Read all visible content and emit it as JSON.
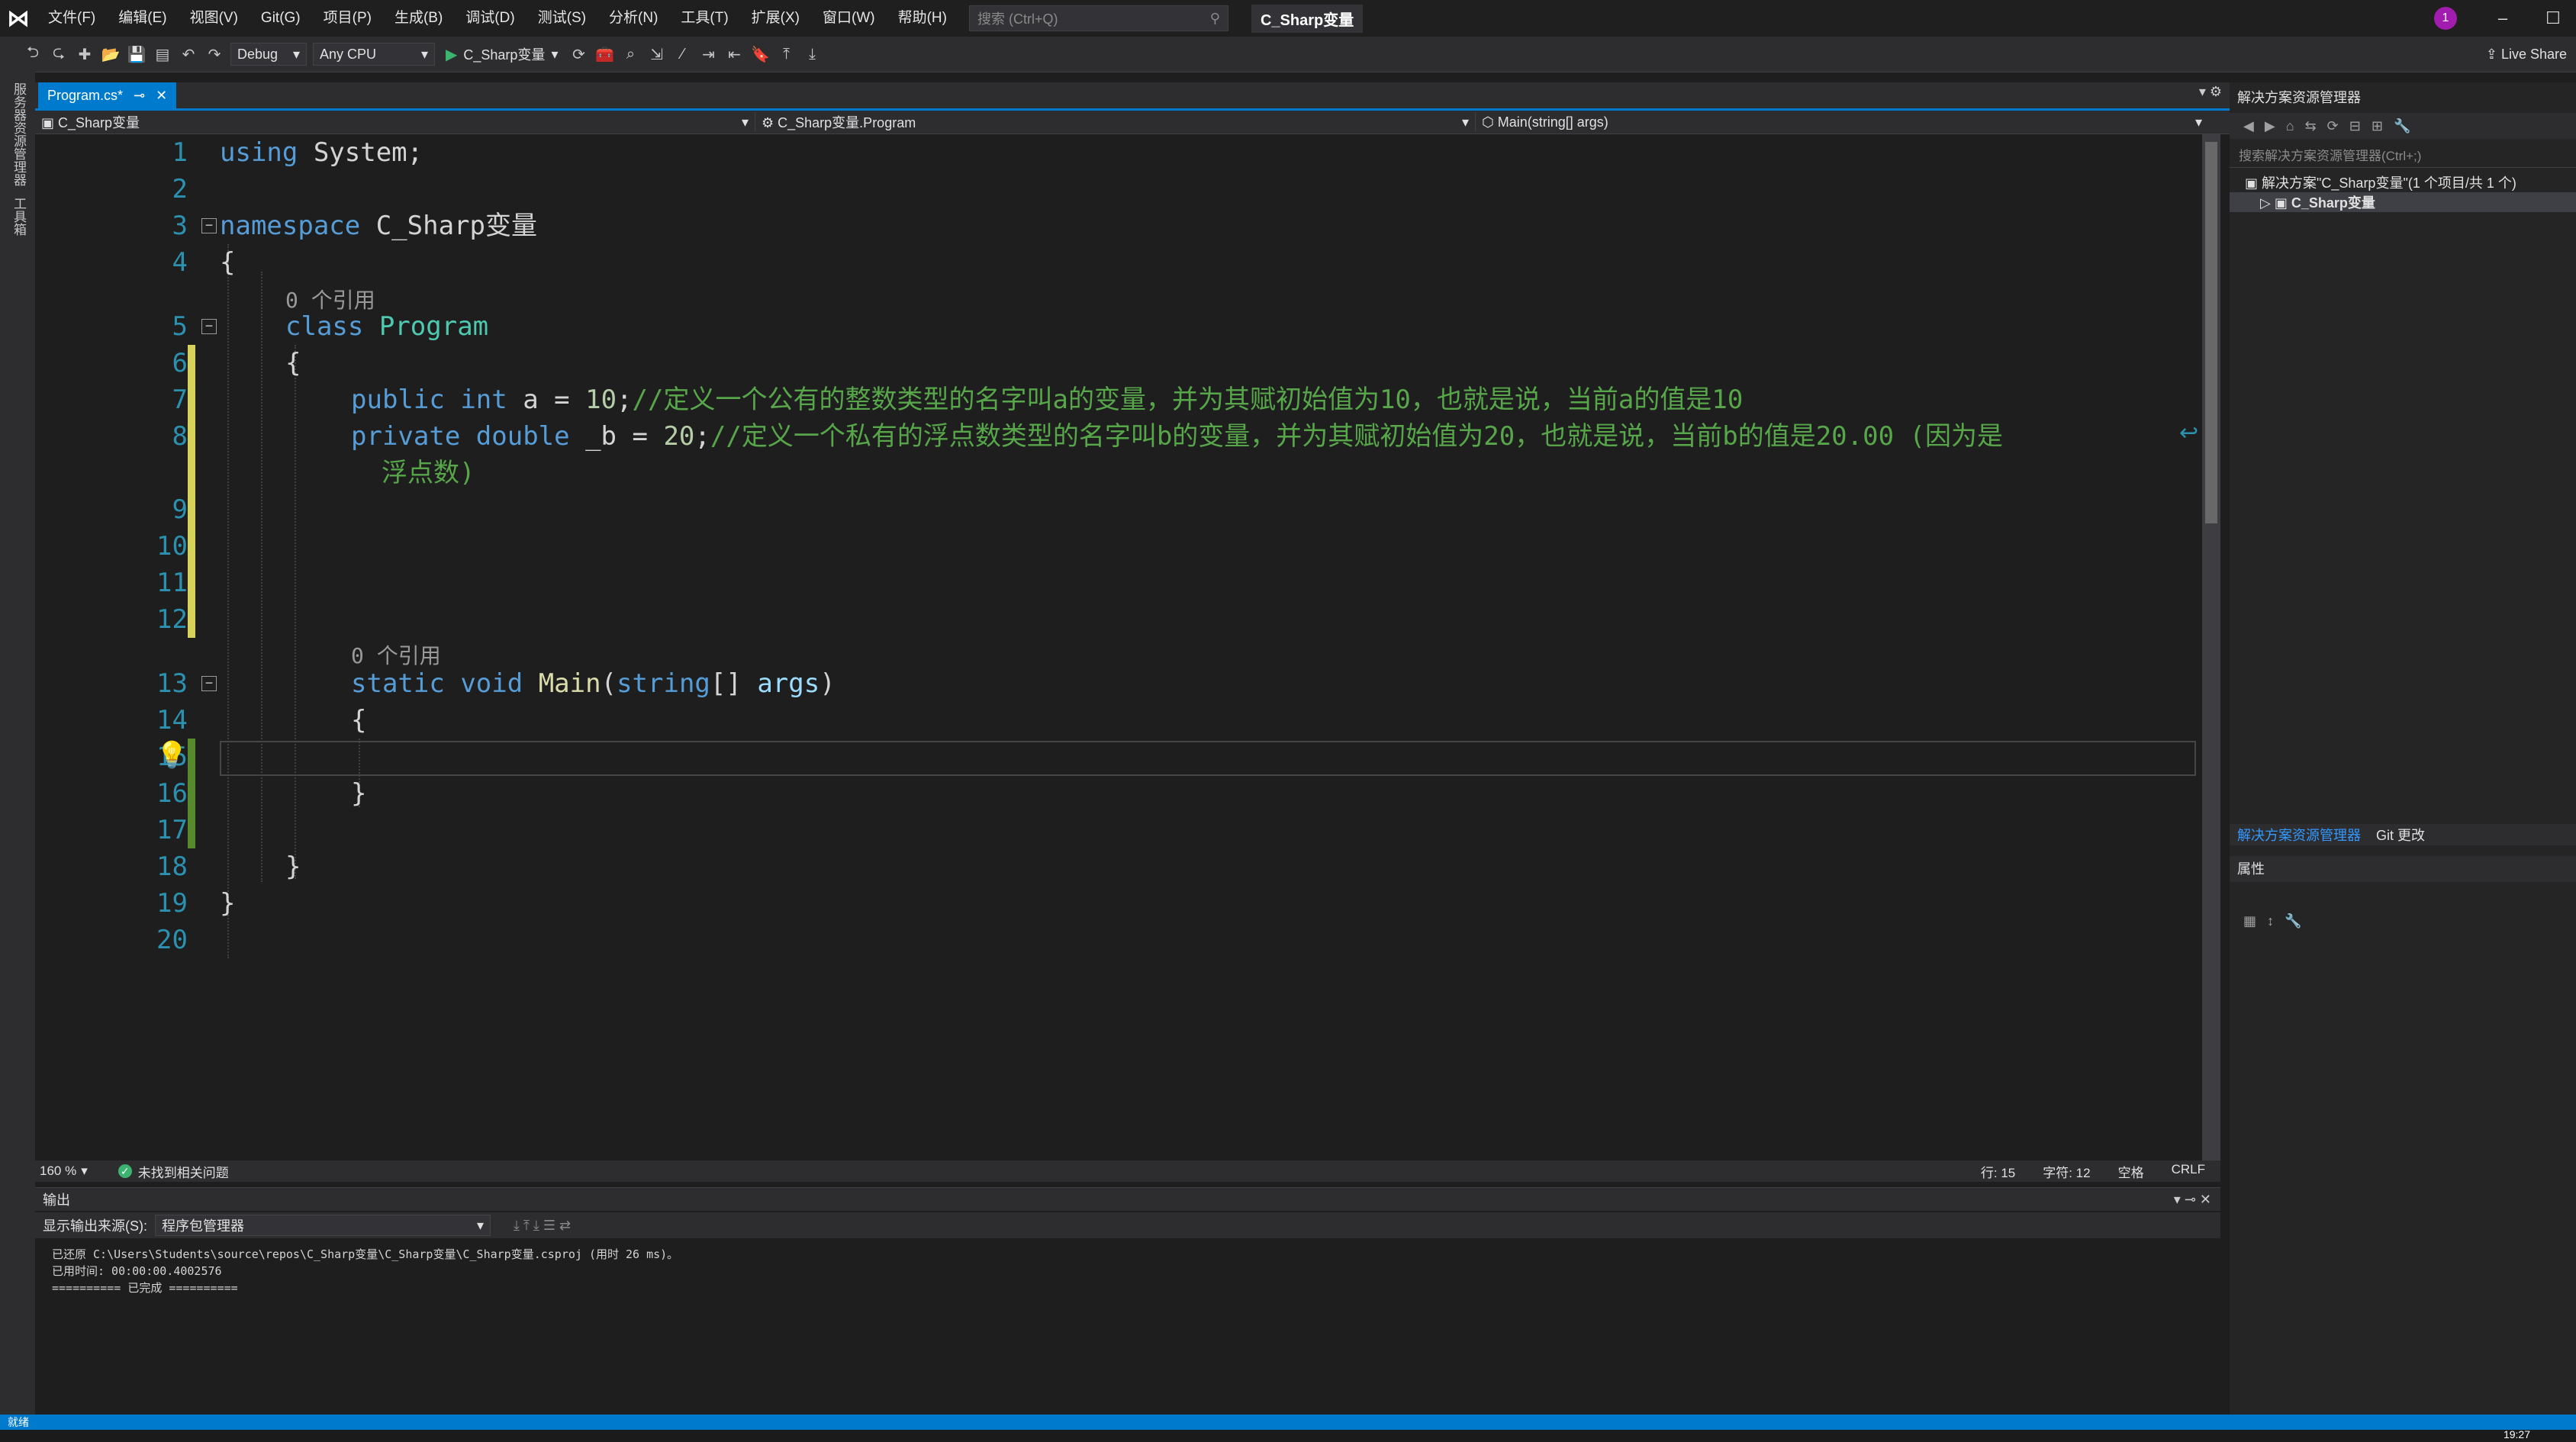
{
  "menu": {
    "items": [
      "文件(F)",
      "编辑(E)",
      "视图(V)",
      "Git(G)",
      "项目(P)",
      "生成(B)",
      "调试(D)",
      "测试(S)",
      "分析(N)",
      "工具(T)",
      "扩展(X)",
      "窗口(W)",
      "帮助(H)"
    ],
    "search_placeholder": "搜索 (Ctrl+Q)",
    "solution_title": "C_Sharp变量",
    "account_badge": "1"
  },
  "toolbar": {
    "config": "Debug",
    "platform": "Any CPU",
    "run_label": "C_Sharp变量",
    "live_share": "Live Share"
  },
  "left_strip": {
    "server_explorer": "服务器资源管理器",
    "toolbox": "工具箱"
  },
  "tabs": {
    "active": "Program.cs*"
  },
  "navbar": {
    "project": "C_Sharp变量",
    "type": "C_Sharp变量.Program",
    "member": "Main(string[] args)"
  },
  "editor": {
    "line_numbers": [
      "1",
      "2",
      "3",
      "4",
      "5",
      "6",
      "7",
      "8",
      "9",
      "10",
      "11",
      "12",
      "13",
      "14",
      "15",
      "16",
      "17",
      "18",
      "19",
      "20"
    ],
    "lines": {
      "l1_kw": "using",
      "l1_rest": " System;",
      "l3_kw": "namespace",
      "l3_rest": " C_Sharp变量",
      "l4": "{",
      "lens_class": "0 个引用",
      "l5_kw": "class",
      "l5_ty": "Program",
      "l6": "{",
      "l7_kw1": "public",
      "l7_kw2": "int",
      "l7_mid": " a = ",
      "l7_num": "10",
      "l7_semi": ";",
      "l7_comment": "//定义一个公有的整数类型的名字叫a的变量，并为其赋初始值为10，也就是说，当前a的值是10",
      "l8_kw1": "private",
      "l8_kw2": "double",
      "l8_mid": " _b = ",
      "l8_num": "20",
      "l8_semi": ";",
      "l8_comment": "//定义一个私有的浮点数类型的名字叫b的变量，并为其赋初始值为20，也就是说，当前b的值是20.00 (因为是",
      "l8_comment_wrap": "浮点数)",
      "lens_main": "0 个引用",
      "l13_kw1": "static",
      "l13_kw2": "void",
      "l13_fn": "Main",
      "l13_open": "(",
      "l13_kw3": "string",
      "l13_br": "[] ",
      "l13_pa": "args",
      "l13_close": ")",
      "l14": "{",
      "l16": "}",
      "l18": "}",
      "l19": "}"
    }
  },
  "editor_status": {
    "zoom": "160 %",
    "issues": "未找到相关问题",
    "line": "行: 15",
    "char": "字符: 12",
    "spacing": "空格",
    "eol": "CRLF"
  },
  "output": {
    "title": "输出",
    "source_label": "显示输出来源(S):",
    "source_value": "程序包管理器",
    "lines": [
      "已还原 C:\\Users\\Students\\source\\repos\\C_Sharp变量\\C_Sharp变量\\C_Sharp变量.csproj (用时 26 ms)。",
      "已用时间: 00:00:00.4002576",
      "========== 已完成 =========="
    ]
  },
  "solution_explorer": {
    "title": "解决方案资源管理器",
    "search_placeholder": "搜索解决方案资源管理器(Ctrl+;)",
    "solution_node": "解决方案\"C_Sharp变量\"(1 个项目/共 1 个)",
    "project_node": "C_Sharp变量",
    "tab_solution": "解决方案资源管理器",
    "tab_git": "Git 更改"
  },
  "properties": {
    "title": "属性"
  },
  "status_bar": {
    "text": "就绪"
  },
  "taskbar": {
    "clock": "19:27"
  },
  "colors": {
    "accent": "#007acc",
    "keyword": "#569cd6",
    "type": "#4ec9b0",
    "comment": "#57a64a",
    "line_number": "#2b91af",
    "change_unsaved": "#d7d35a",
    "change_saved": "#578a2c"
  }
}
